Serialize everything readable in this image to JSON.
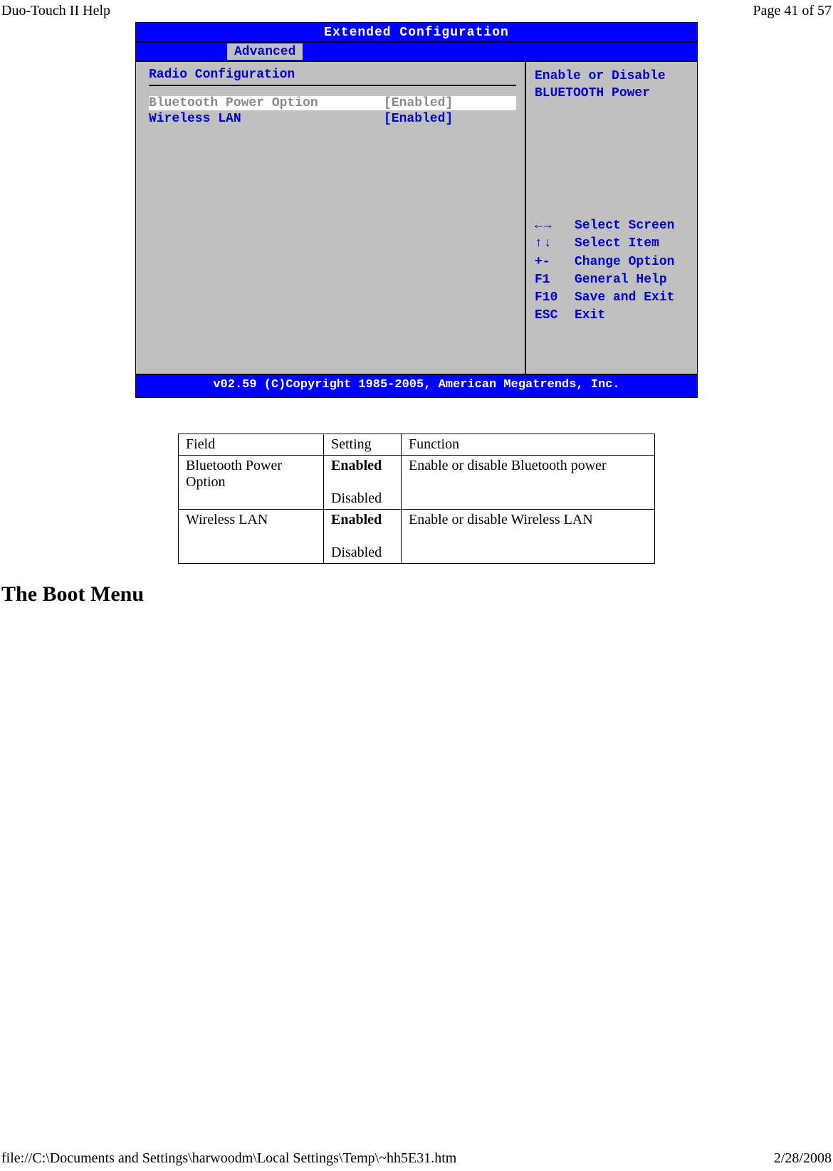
{
  "header": {
    "left": "Duo-Touch II Help",
    "right": "Page 41 of 57"
  },
  "bios": {
    "title": "Extended Configuration",
    "menu": {
      "advanced": "Advanced"
    },
    "section": "Radio Configuration",
    "rows": [
      {
        "label": "Bluetooth Power Option",
        "value": "[Enabled]",
        "selected": true
      },
      {
        "label": "Wireless LAN",
        "value": "[Enabled]",
        "selected": false
      }
    ],
    "help": {
      "l1": "Enable or Disable",
      "l2": "BLUETOOTH Power"
    },
    "keys": {
      "select_screen": "Select Screen",
      "select_item": "Select Item",
      "plusminus": "+-",
      "change": "Change Option",
      "f1": "F1",
      "general": "General Help",
      "f10": "F10",
      "save": "Save and Exit",
      "esc": "ESC",
      "exit": "Exit"
    },
    "footer": "v02.59 (C)Copyright 1985-2005, American Megatrends, Inc."
  },
  "table": {
    "head": {
      "field": "Field",
      "setting": "Setting",
      "function": "Function"
    },
    "rows": [
      {
        "field": "Bluetooth Power Option",
        "s1": "Enabled",
        "s2": "Disabled",
        "func": "Enable or disable Bluetooth power"
      },
      {
        "field": "Wireless LAN",
        "s1": "Enabled",
        "s2": "Disabled",
        "func": "Enable or disable Wireless LAN"
      }
    ]
  },
  "heading": "The Boot Menu",
  "footer": {
    "left": "file://C:\\Documents and Settings\\harwoodm\\Local Settings\\Temp\\~hh5E31.htm",
    "right": "2/28/2008"
  }
}
